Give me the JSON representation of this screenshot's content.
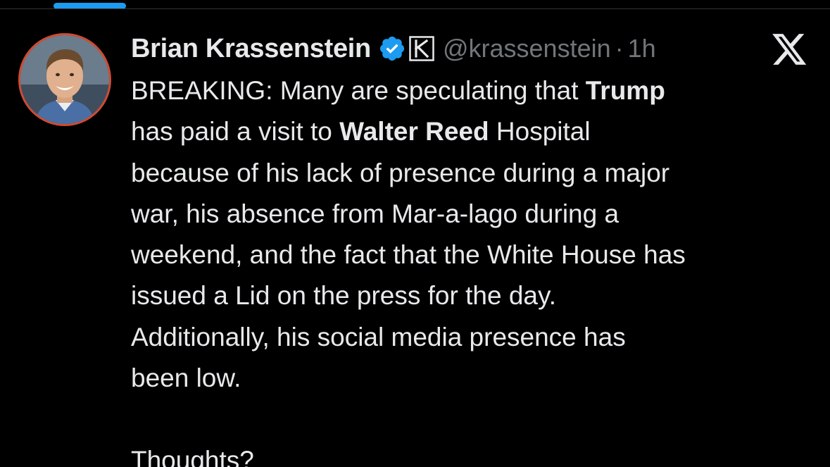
{
  "tweet": {
    "author": {
      "display_name": "Brian Krassenstein",
      "handle": "@krassenstein",
      "verified": true,
      "verified_color": "#1d9bf0",
      "avatar_border_color": "#d04a32"
    },
    "separator": "·",
    "timestamp": "1h",
    "platform_logo": "x-logo-icon",
    "body_lines": [
      [
        {
          "text": "BREAKING: Many are speculating that ",
          "bold": false
        },
        {
          "text": "Trump",
          "bold": true
        }
      ],
      [
        {
          "text": "has paid a visit to ",
          "bold": false
        },
        {
          "text": "Walter Reed",
          "bold": true
        },
        {
          "text": " Hospital",
          "bold": false
        }
      ],
      [
        {
          "text": "because of his lack of presence during a major",
          "bold": false
        }
      ],
      [
        {
          "text": "war, his absence from Mar-a-lago during a",
          "bold": false
        }
      ],
      [
        {
          "text": "weekend, and the fact that the White House has",
          "bold": false
        }
      ],
      [
        {
          "text": "issued a Lid on the press for the day.",
          "bold": false
        }
      ],
      [
        {
          "text": "Additionally, his social media presence has",
          "bold": false
        }
      ],
      [
        {
          "text": "been low.",
          "bold": false
        }
      ],
      [],
      [
        {
          "text": "Thoughts?",
          "bold": false
        }
      ]
    ]
  },
  "colors": {
    "background": "#000000",
    "text_primary": "#e7e9ea",
    "text_secondary": "#71767b",
    "accent": "#1d9bf0",
    "divider": "#2f3336"
  }
}
